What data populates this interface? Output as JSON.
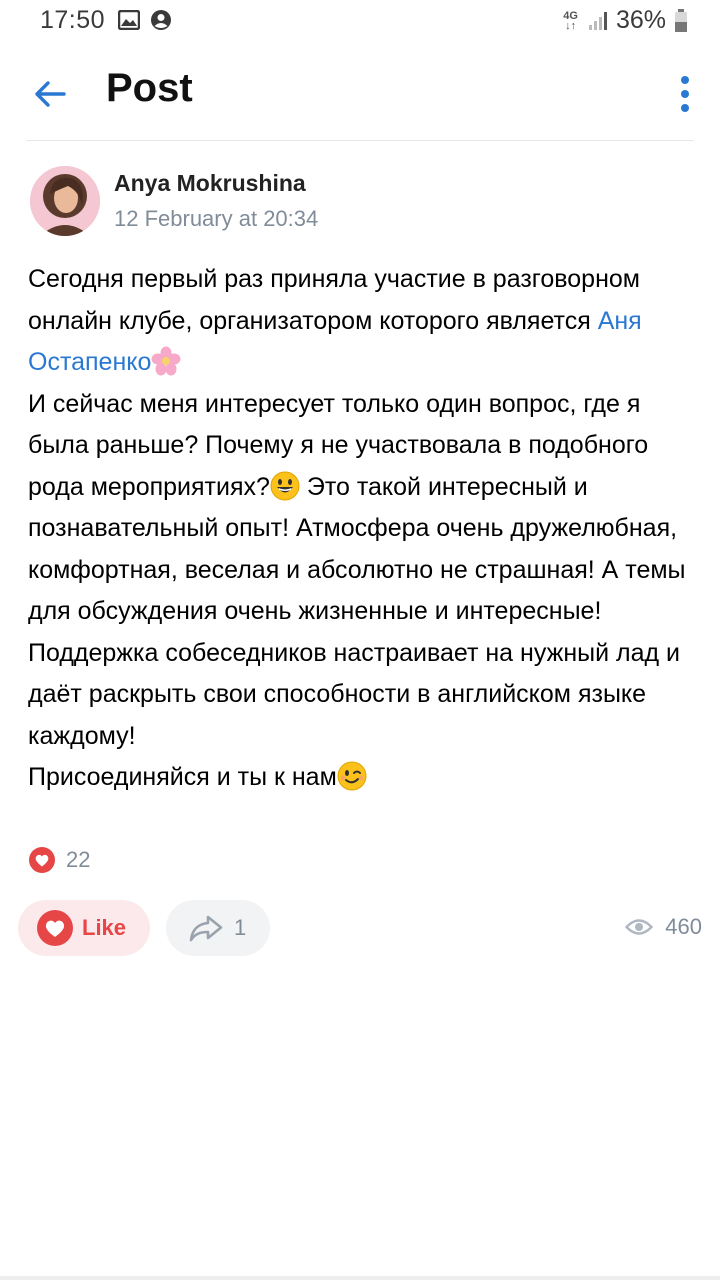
{
  "status_bar": {
    "time": "17:50",
    "network": "4G",
    "battery": "36%"
  },
  "header": {
    "title": "Post"
  },
  "post": {
    "author": "Anya Mokrushina",
    "date": "12 February at 20:34",
    "text_1": "Сегодня первый раз приняла участие в разговорном онлайн клубе, организатором которого является ",
    "mention": "Аня Остапенко",
    "text_2": "И сейчас меня интересует только один вопрос, где я была раньше? Почему я не участвовала в подобного рода мероприятиях?",
    "text_3": " Это такой интересный и познавательный опыт! Атмосфера очень дружелюбная, комфортная, веселая и абсолютно не страшная! А темы для обсуждения очень жизненные и интересные! Поддержка собеседников настраивает на нужный лад и даёт раскрыть свои способности в английском языке каждому!",
    "text_4": "Присоединяйся и ты к нам",
    "reactions_count": "22"
  },
  "actions": {
    "like_label": "Like",
    "share_count": "1",
    "views_count": "460"
  },
  "colors": {
    "accent": "#2a78d2",
    "like": "#e64646",
    "muted": "#818c99"
  },
  "icons": [
    "back-arrow-icon",
    "more-vertical-icon",
    "heart-icon",
    "share-icon",
    "eye-icon",
    "image-icon",
    "account-icon",
    "signal-icon",
    "battery-icon",
    "flower-emoji",
    "grin-emoji",
    "wink-emoji"
  ]
}
